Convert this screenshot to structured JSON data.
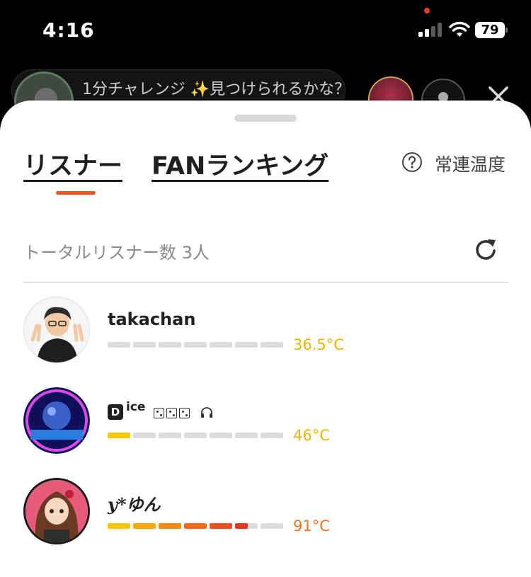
{
  "status_bar": {
    "time": "4:16",
    "battery": "79"
  },
  "room": {
    "title": "1分チャレンジ ✨見つけられるかな？"
  },
  "sheet": {
    "tabs": [
      {
        "label": "リスナー",
        "active": true
      },
      {
        "label": "FANランキング",
        "active": false
      }
    ],
    "help_label": "常連温度",
    "total_label": "トータルリスナー数 3人",
    "accent_color": "#f2541b"
  },
  "listeners": [
    {
      "name": "takachan",
      "name_prefix": "",
      "name_sup": "",
      "temperature": "36.5°C",
      "temperature_value": 36.5,
      "temperature_color": "#f0b400",
      "filled_segments": 0
    },
    {
      "name": "",
      "name_prefix": "D",
      "name_sup": "ice",
      "temperature": "46°C",
      "temperature_value": 46,
      "temperature_color": "#f0b400",
      "filled_segments": 1
    },
    {
      "name": "y*ゆん",
      "name_prefix": "",
      "name_sup": "",
      "temperature": "91°C",
      "temperature_value": 91,
      "temperature_color": "#f07020",
      "filled_segments": 6
    }
  ]
}
